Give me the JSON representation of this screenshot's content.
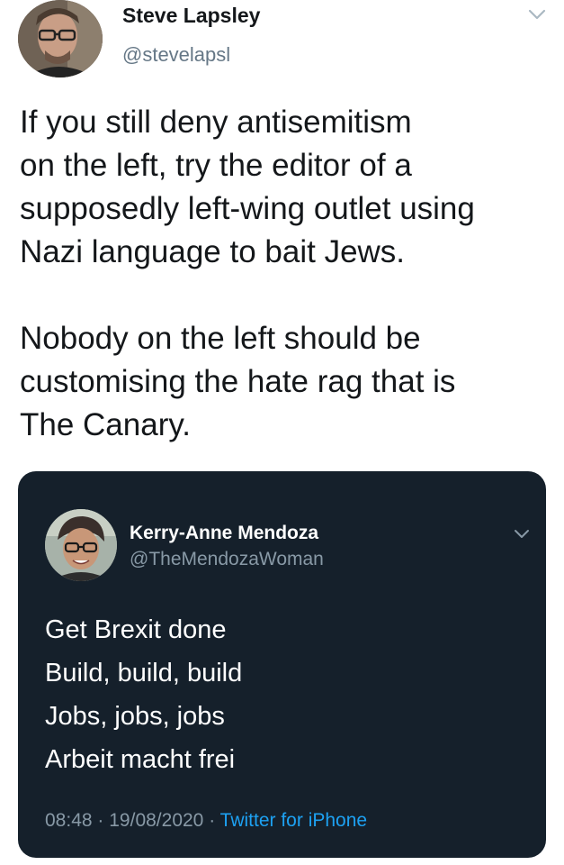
{
  "tweet": {
    "author_name": "Steve Lapsley",
    "author_handle": "@stevelapsl",
    "text_lines": [
      "If you still deny antisemitism",
      "on the left, try the editor of a",
      "supposedly left-wing outlet using",
      "Nazi language to bait Jews.",
      "Nobody on the left should be",
      "customising the hate rag that is",
      "The Canary."
    ],
    "menu_icon": "chevron-down-icon"
  },
  "quoted_tweet": {
    "author_name": "Kerry-Anne Mendoza",
    "author_handle": "@TheMendozaWoman",
    "text_lines": [
      "Get Brexit done",
      "Build, build, build",
      "Jobs, jobs, jobs",
      "Arbeit macht frei"
    ],
    "time": "08:48",
    "date": "19/08/2020",
    "source": "Twitter for iPhone",
    "separator": "·",
    "menu_icon": "chevron-down-icon"
  },
  "colors": {
    "card_background": "#15202b",
    "secondary_text_light": "#657786",
    "secondary_text_dark": "#8899a6",
    "link_blue": "#1da1f2"
  }
}
